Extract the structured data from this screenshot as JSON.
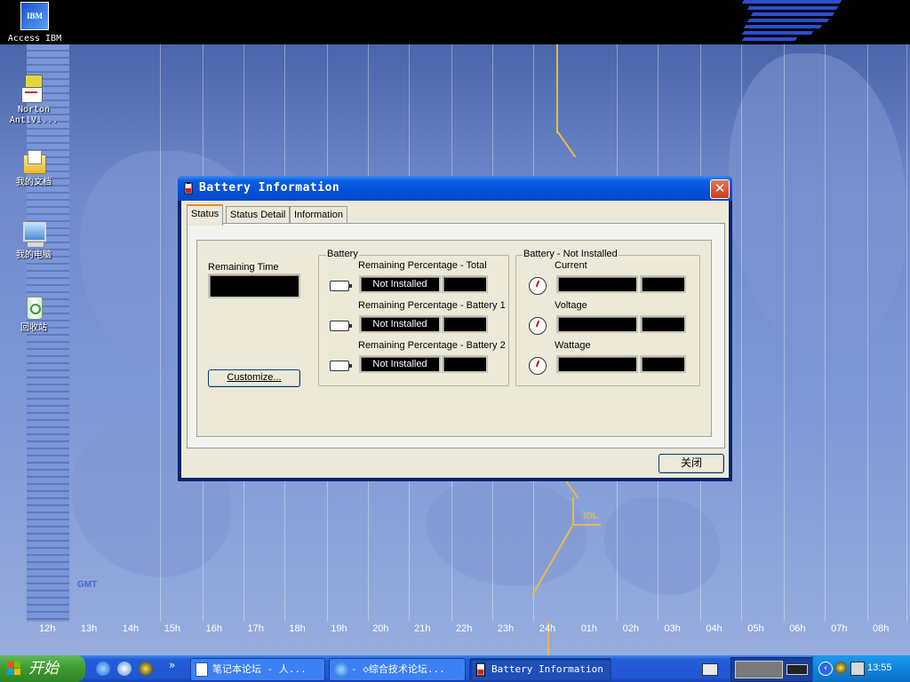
{
  "desktop": {
    "top_label": "Access IBM",
    "ibm_small_text": "IBM",
    "icons": [
      {
        "label_line1": "Norton",
        "label_line2": "AntiVi...",
        "icon": "norton-antivirus-icon"
      },
      {
        "label_line1": "我的文档",
        "label_line2": "",
        "icon": "my-documents-icon"
      },
      {
        "label_line1": "我的电脑",
        "label_line2": "",
        "icon": "my-computer-icon"
      },
      {
        "label_line1": "回收站",
        "label_line2": "",
        "icon": "recycle-bin-icon"
      }
    ],
    "map": {
      "gmt_label": "GMT",
      "idl_label": "IDL",
      "hours": [
        "12h",
        "13h",
        "14h",
        "15h",
        "16h",
        "17h",
        "18h",
        "19h",
        "20h",
        "21h",
        "22h",
        "23h",
        "24h",
        "01h",
        "02h",
        "03h",
        "04h",
        "05h",
        "06h",
        "07h",
        "08h"
      ]
    }
  },
  "dialog": {
    "title": "Battery Information",
    "close_glyph": "✕",
    "tabs": [
      "Status",
      "Status Detail",
      "Information"
    ],
    "active_tab": "Status",
    "remaining_time": {
      "label": "Remaining Time",
      "value": ""
    },
    "customize_button": "Customize...",
    "battery_group": {
      "title": "Battery",
      "rows": [
        {
          "label": "Remaining Percentage - Total",
          "value": "Not Installed",
          "extra": ""
        },
        {
          "label": "Remaining Percentage - Battery 1",
          "value": "Not Installed",
          "extra": ""
        },
        {
          "label": "Remaining Percentage - Battery 2",
          "value": "Not Installed",
          "extra": ""
        }
      ]
    },
    "status_group": {
      "title": "Battery - Not Installed",
      "rows": [
        {
          "label": "Current",
          "value": "",
          "extra": ""
        },
        {
          "label": "Voltage",
          "value": "",
          "extra": ""
        },
        {
          "label": "Wattage",
          "value": "",
          "extra": ""
        }
      ]
    },
    "footer_button": "关闭"
  },
  "taskbar": {
    "start_label": "开始",
    "quicklaunch_more": "»",
    "windows": [
      {
        "label": "笔记本论坛 - 人...",
        "active": false
      },
      {
        "label": "- ◇综合技术论坛...",
        "active": false
      },
      {
        "label": "Battery Information",
        "active": true
      }
    ],
    "clock": "13:55"
  },
  "colors": {
    "titlebar": "#0550d8",
    "close_button": "#c83d1c",
    "start_button": "#3c9a2f",
    "taskbar": "#245edb",
    "tab_highlight": "#e68b2c",
    "idl_line": "#e8b84a"
  }
}
